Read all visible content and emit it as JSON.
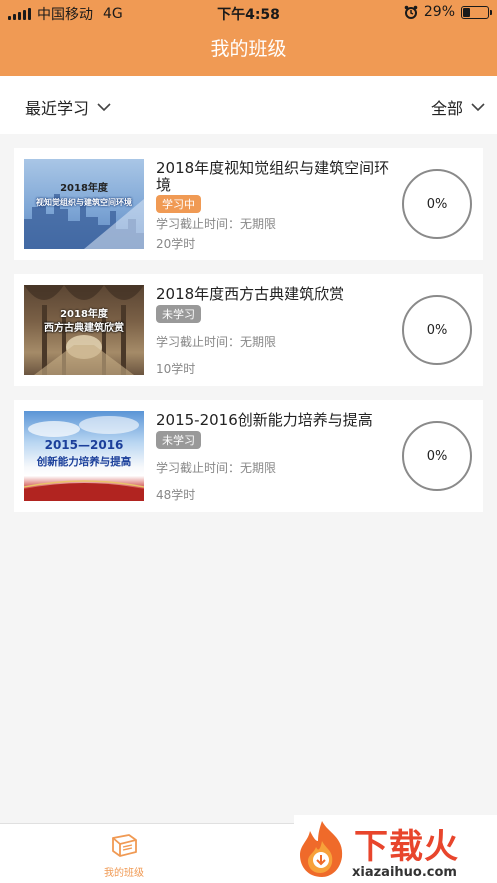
{
  "status_bar": {
    "carrier": "中国移动",
    "network": "4G",
    "time": "下午4:58",
    "battery": "29%",
    "battery_level": 0.29
  },
  "header": {
    "title": "我的班级"
  },
  "filters": {
    "left": "最近学习",
    "right": "全部"
  },
  "courses": [
    {
      "title": "2018年度视知觉组织与建筑空间环境",
      "status": "学习中",
      "deadline": "学习截止时间：无期限",
      "hours": "20学时",
      "progress": "0%",
      "thumb_line1": "2018年度",
      "thumb_line2": "视知觉组织与建筑空间环境"
    },
    {
      "title": "2018年度西方古典建筑欣赏",
      "status": "未学习",
      "deadline": "学习截止时间：无期限",
      "hours": "10学时",
      "progress": "0%",
      "thumb_line1": "2018年度",
      "thumb_line2": "西方古典建筑欣赏"
    },
    {
      "title": "2015-2016创新能力培养与提高",
      "status": "未学习",
      "deadline": "学习截止时间：无期限",
      "hours": "48学时",
      "progress": "0%",
      "thumb_line1": "2015—2016",
      "thumb_line2": "创新能力培养与提高"
    }
  ],
  "tabbar": {
    "tab1": "我的班级"
  },
  "watermark": {
    "name": "下载火",
    "url": "xiazaihuo.com"
  },
  "colors": {
    "accent": "#f09a54",
    "badge_off": "#999999"
  }
}
